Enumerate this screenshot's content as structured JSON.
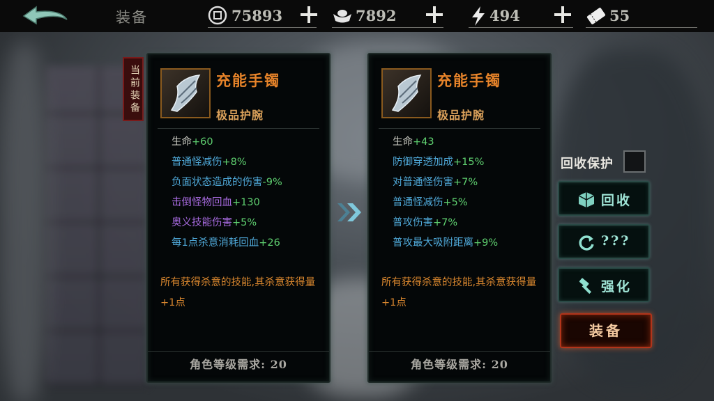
{
  "header": {
    "title": "装备",
    "resources": [
      {
        "icon": "coin-icon",
        "value": "75893"
      },
      {
        "icon": "silver-ingot-icon",
        "value": "7892"
      },
      {
        "icon": "lightning-icon",
        "value": "494"
      },
      {
        "icon": "ticket-icon",
        "value": "55"
      }
    ]
  },
  "current_tag": "当前装备",
  "left_item": {
    "name": "充能手镯",
    "type": "极品护腕",
    "stats": [
      {
        "label": "生命",
        "bonus": "+60",
        "color": "#c8c8c0"
      },
      {
        "label": "普通怪减伤",
        "bonus": "+8%",
        "color": "#4fa8d8"
      },
      {
        "label": "负面状态造成的伤害",
        "bonus": "-9%",
        "color": "#4fa8d8"
      },
      {
        "label": "击倒怪物回血",
        "bonus": "+130",
        "color": "#a86be0"
      },
      {
        "label": "奥义技能伤害",
        "bonus": "+5%",
        "color": "#a86be0"
      },
      {
        "label": "每1点杀意消耗回血",
        "bonus": "+26",
        "color": "#4fa8d8"
      }
    ],
    "description": "所有获得杀意的技能,其杀意获得量+1点",
    "requirement": "角色等级需求: 20"
  },
  "right_item": {
    "name": "充能手镯",
    "type": "极品护腕",
    "stats": [
      {
        "label": "生命",
        "bonus": "+43",
        "color": "#c8c8c0"
      },
      {
        "label": "防御穿透加成",
        "bonus": "+15%",
        "color": "#4fa8d8"
      },
      {
        "label": "对普通怪伤害",
        "bonus": "+7%",
        "color": "#4fa8d8"
      },
      {
        "label": "普通怪减伤",
        "bonus": "+5%",
        "color": "#4fa8d8"
      },
      {
        "label": "普攻伤害",
        "bonus": "+7%",
        "color": "#4fa8d8"
      },
      {
        "label": "普攻最大吸附距离",
        "bonus": "+9%",
        "color": "#4fa8d8"
      }
    ],
    "description": "所有获得杀意的技能,其杀意获得量+1点",
    "requirement": "角色等级需求: 20"
  },
  "actions": {
    "protect_label": "回收保护",
    "recycle_label": "回收",
    "unknown_label": "???",
    "enhance_label": "强化",
    "equip_label": "装备"
  },
  "colors": {
    "bonus_green": "#5fd070",
    "orange_text": "#e8842a",
    "button_teal": "#9fe4d6",
    "equip_red": "#b2341a"
  }
}
